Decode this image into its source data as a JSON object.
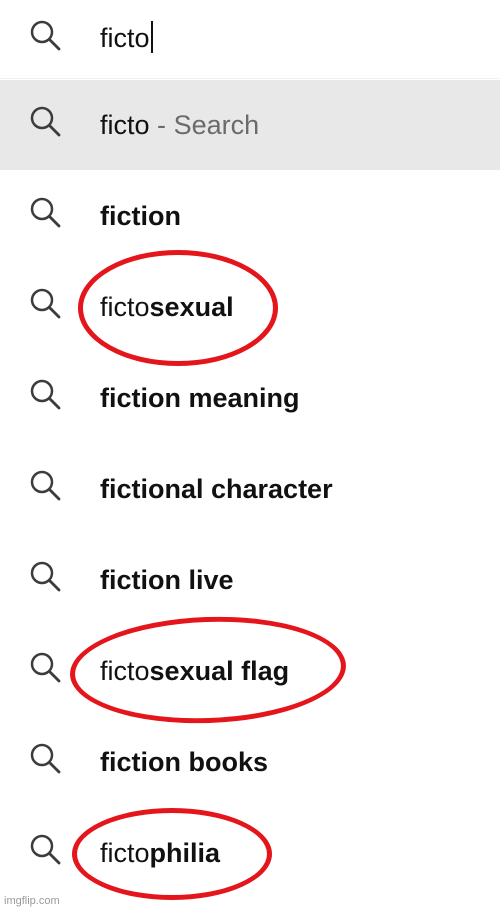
{
  "search": {
    "query": "ficto"
  },
  "top_suggestion": {
    "query": "ficto",
    "separator": "-",
    "action": "Search"
  },
  "suggestions": [
    {
      "prefix": "",
      "completion": "fiction"
    },
    {
      "prefix": "ficto",
      "completion": "sexual"
    },
    {
      "prefix": "",
      "completion": "fiction meaning"
    },
    {
      "prefix": "",
      "completion": "fictional character"
    },
    {
      "prefix": "",
      "completion": "fiction live"
    },
    {
      "prefix": "ficto",
      "completion": "sexual flag"
    },
    {
      "prefix": "",
      "completion": "fiction books"
    },
    {
      "prefix": "ficto",
      "completion": "philia"
    }
  ],
  "annotation_color": "#e4151b",
  "icons": {
    "search": "search-icon"
  },
  "watermark": "imgflip.com"
}
